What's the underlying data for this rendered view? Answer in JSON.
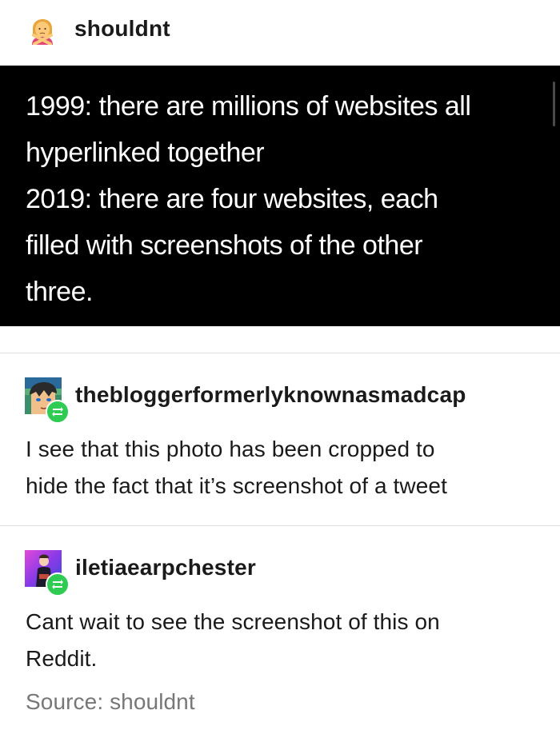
{
  "post": {
    "author": "shouldnt",
    "image_text_lines": [
      "1999: there are millions of websites all",
      "hyperlinked together",
      "2019: there are four websites, each",
      "filled with screenshots of the other",
      "three."
    ]
  },
  "reblogs": [
    {
      "username": "thebloggerformerlyknownasmadcap",
      "text": [
        "I see that this photo has been cropped to",
        "hide the fact that it’s screenshot of a tweet"
      ]
    },
    {
      "username": "iletiaearpchester",
      "text": [
        "Cant wait to see the screenshot of this on",
        "Reddit."
      ]
    }
  ],
  "footer": {
    "source_label": "Source: shouldnt"
  },
  "icons": {
    "post_author_avatar": "person-gesturing-no-emoji-icon",
    "reblog_badge": "reblog-icon"
  },
  "colors": {
    "reblog_badge_green": "#2ecc52",
    "tweet_background": "#000000",
    "source_text": "#777777"
  }
}
